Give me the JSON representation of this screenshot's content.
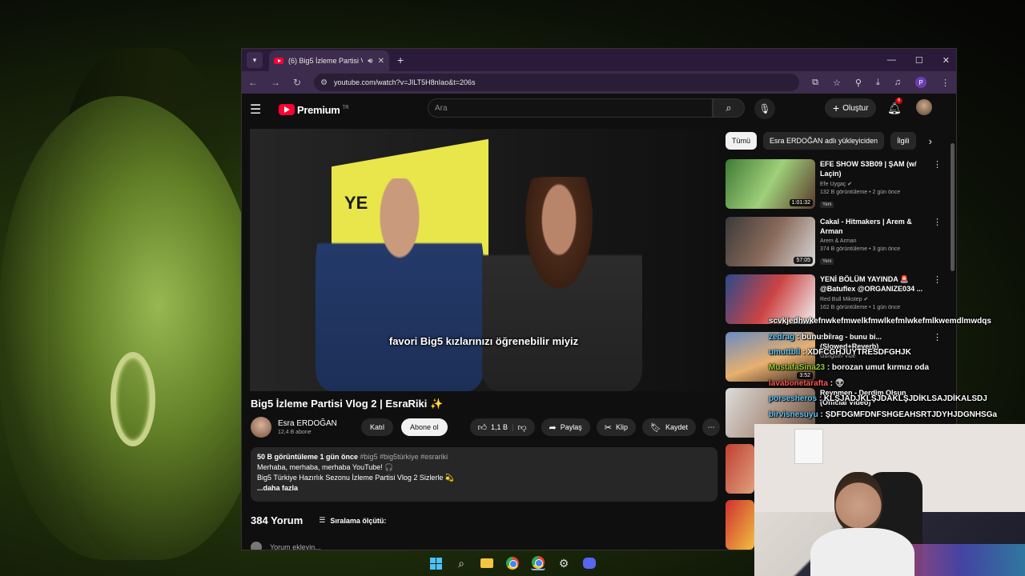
{
  "browser": {
    "tab_title": "(6) Big5 İzleme Partisi Vlog",
    "url": "youtube.com/watch?v=JILT5H8nIao&t=206s",
    "profile_initial": "P"
  },
  "youtube": {
    "logo_text": "Premium",
    "logo_sup": "TR",
    "search_placeholder": "Ara",
    "create_label": "Oluştur",
    "notif_count": "6",
    "subtitle": "favori Big5 kızlarınızı öğrenebilir miyiz",
    "video_title": "Big5 İzleme Partisi Vlog 2 | EsraRiki ✨",
    "channel_name": "Esra ERDOĞAN",
    "channel_subs": "12,4 B abone",
    "join_label": "Katıl",
    "subscribe_label": "Abone ol",
    "like_count": "1,1 B",
    "share_label": "Paylaş",
    "clip_label": "Klip",
    "save_label": "Kaydet",
    "desc_meta": "50 B görüntüleme  1 gün önce",
    "desc_tags": "#big5 #big5türkiye #esrariki",
    "desc_line1": "Merhaba, merhaba, merhaba YouTube! 🎧",
    "desc_line2": "Big5 Türkiye Hazırlık Sezonu İzleme Partisi Vlog 2 Sizlerle 💫",
    "desc_more": "...daha fazla",
    "comment_count": "384 Yorum",
    "sort_label": "Sıralama ölçütü:",
    "add_comment": "Yorum ekleyin...",
    "chips": [
      "Tümü",
      "Esra ERDOĞAN adlı yükleyiciden",
      "İlgili"
    ],
    "recs": [
      {
        "title": "EFE SHOW S3B09 | ŞAM (w/ Laçin)",
        "channel": "Efe Uygaç",
        "meta": "132 B görüntüleme • 2 gün önce",
        "badge": "Yeni",
        "duration": "1:01:32"
      },
      {
        "title": "Cakal - Hitmakers | Arem & Arman",
        "channel": "Arem & Arman",
        "meta": "374 B görüntüleme • 3 gün önce",
        "badge": "Yeni",
        "duration": "57:05"
      },
      {
        "title": "YENİ BÖLÜM YAYINDA 🚨 @Batuflex @ORGANIZE034 ...",
        "channel": "Red Bull Mikstep",
        "meta": "162 B görüntüleme • 1 gün önce",
        "badge": "",
        "duration": ""
      },
      {
        "title": "zedrag - bunu bi... (Slowed+Reverb)",
        "channel": "Gangster Vibe",
        "meta": "",
        "badge": "",
        "duration": "3:52"
      },
      {
        "title": "Reynmen - Derdim Olsun (Official Video)",
        "channel": "",
        "meta": "",
        "badge": "",
        "duration": ""
      }
    ]
  },
  "chat": [
    {
      "user": "",
      "text": "scvkjedhwkefnwkefmwelkfmwlkefmlwkefmlkwemdlmwdqs"
    },
    {
      "user": "zedrag",
      "text": ": bunu bi"
    },
    {
      "user": "umuttbll",
      "text": ": XDFCGHJUYTRESDFGHJK"
    },
    {
      "user": "MustafaSina23",
      "text": ": borozan umut kırmızı oda"
    },
    {
      "user": "lavabonetarafta",
      "text": ": 👽"
    },
    {
      "user": "porsesheros",
      "text": ": KLŞJADJKLŞJDAKLŞJDİKLSAJDİKALSDJ"
    },
    {
      "user": "birvisnesuyu",
      "text": ": ŞDFDGMFDNFSHGEAHSRTJDYHJDGNHSGa"
    }
  ],
  "colors": {
    "yt_red": "#ff0033",
    "chrome_frame": "#3d2c4d",
    "page_bg": "#0f0f0f"
  }
}
